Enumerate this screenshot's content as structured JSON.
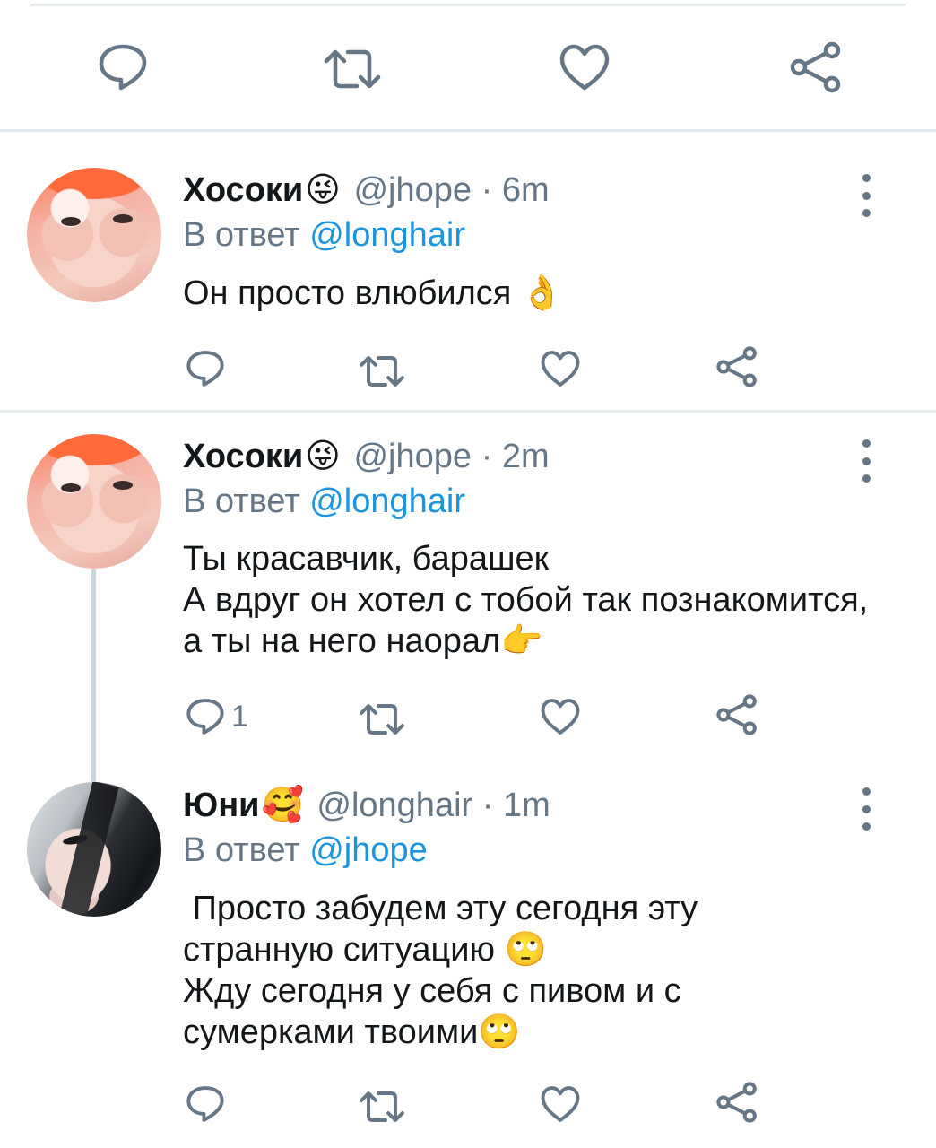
{
  "colors": {
    "icon_gray": "#657786",
    "link_blue": "#1b95e0",
    "text": "#14171a",
    "divider": "#e6ecf0",
    "thread_line": "#ccd6dd"
  },
  "top_actions": {
    "reply_icon": "reply-icon",
    "retweet_icon": "retweet-icon",
    "like_icon": "heart-icon",
    "share_icon": "share-icon"
  },
  "tweets": [
    {
      "name": "Хосоки",
      "name_emoji": "😜",
      "handle": "@jhope",
      "separator": "·",
      "time": "6m",
      "reply_prefix": "В ответ",
      "reply_to": "@longhair",
      "text": "Он просто влюбился 👌",
      "reply_count": ""
    },
    {
      "name": "Хосоки",
      "name_emoji": "😜",
      "handle": "@jhope",
      "separator": "·",
      "time": "2m",
      "reply_prefix": "В ответ",
      "reply_to": "@longhair",
      "text": "Ты красавчик, барашек\nА вдруг он хотел с тобой так познакомится, а ты на него наорал👉",
      "reply_count": "1"
    },
    {
      "name": "Юни",
      "name_emoji": "🥰",
      "handle": "@longhair",
      "separator": "·",
      "time": "1m",
      "reply_prefix": "В ответ",
      "reply_to": "@jhope",
      "text": " Просто забудем эту сегодня эту странную ситуацию 🙄\nЖду сегодня у себя с пивом и с сумерками твоими🙄",
      "reply_count": ""
    }
  ]
}
